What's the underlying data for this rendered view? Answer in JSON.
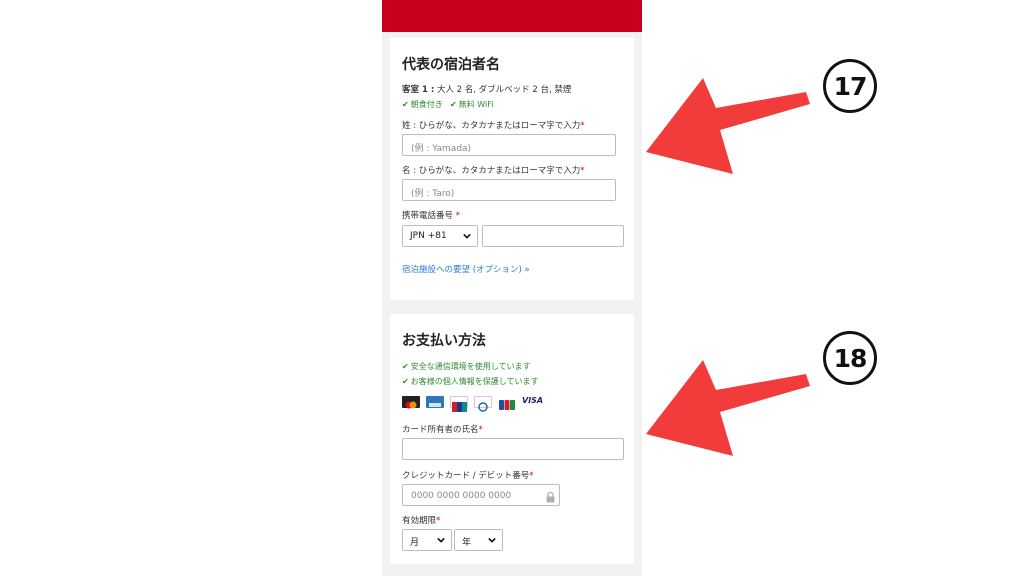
{
  "guest": {
    "title": "代表の宿泊者名",
    "room_label": "客室 1 :",
    "room_detail": "大人 2 名, ダブルベッド 2 台, 禁煙",
    "amenities": [
      "朝食付き",
      "無料 WiFi"
    ],
    "last_name_label": "姓 : ひらがな、カタカナまたはローマ字で入力",
    "last_name_placeholder": "(例 : Yamada)",
    "first_name_label": "名 : ひらがな、カタカナまたはローマ字で入力",
    "first_name_placeholder": "(例 : Taro)",
    "phone_label": "携帯電話番号",
    "phone_country": "JPN +81",
    "request_link": "宿泊施設への要望 (オプション)"
  },
  "payment": {
    "title": "お支払い方法",
    "secure_notes": [
      "安全な通信環境を使用しています",
      "お客様の個人情報を保護しています"
    ],
    "card_logos": [
      "mastercard-icon",
      "amex-icon",
      "unionpay-icon",
      "diners-icon",
      "jcb-icon",
      "visa-icon"
    ],
    "visa_text": "VISA",
    "holder_label": "カード所有者の氏名",
    "number_label": "クレジットカード / デビット番号",
    "number_placeholder": "0000 0000 0000 0000",
    "expiry_label": "有効期限",
    "month": "月",
    "year": "年"
  },
  "annotations": {
    "first": "17",
    "second": "18"
  },
  "colors": {
    "brand_red": "#c8001e",
    "arrow_red": "#f23b3b",
    "check_green": "#2e8b2e",
    "link_blue": "#2a7bd5"
  }
}
